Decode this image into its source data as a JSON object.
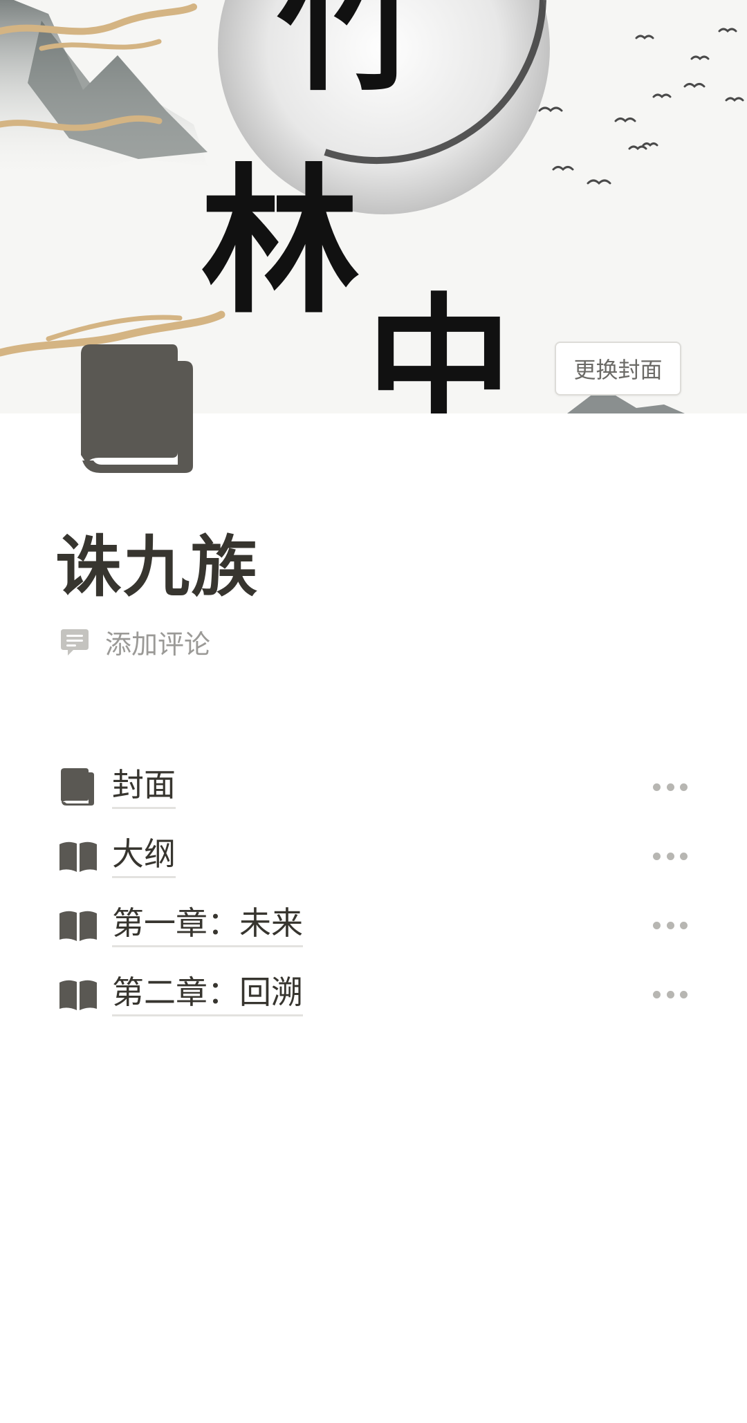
{
  "cover": {
    "image_text": "竹林中",
    "change_cover_label": "更换封面"
  },
  "page": {
    "icon": "book-icon",
    "title": "诛九族",
    "add_comment_label": "添加评论",
    "add_comment_icon": "comment-icon"
  },
  "subpages": [
    {
      "icon": "closed-book-icon",
      "label": "封面"
    },
    {
      "icon": "open-book-icon",
      "label": "大纲"
    },
    {
      "icon": "open-book-icon",
      "label": "第一章：未来"
    },
    {
      "icon": "open-book-icon",
      "label": "第二章：回溯"
    }
  ],
  "colors": {
    "text": "#37352f",
    "muted": "#9b9a97",
    "icon": "#5a5853",
    "gold": "#d4b483"
  }
}
